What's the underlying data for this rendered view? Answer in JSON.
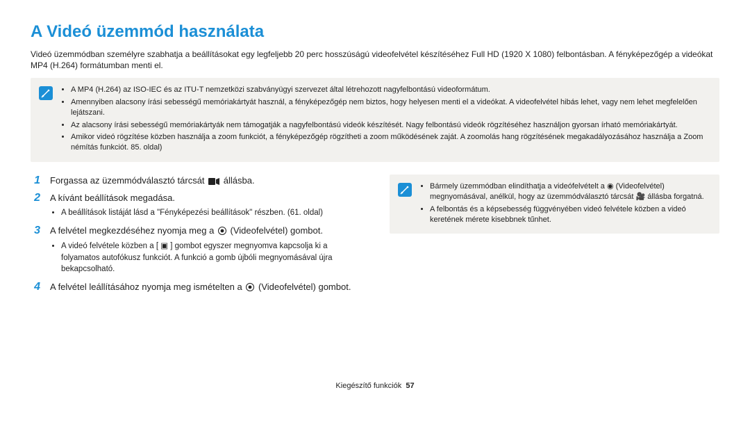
{
  "title": "A Videó üzemmód használata",
  "intro": "Videó üzemmódban személyre szabhatja a beállításokat egy legfeljebb 20 perc hosszúságú videofelvétel készítéséhez Full HD (1920 X 1080) felbontásban. A fényképezőgép a videókat MP4 (H.264) formátumban menti el.",
  "notes_top": [
    "A MP4 (H.264) az ISO-IEC és az ITU-T nemzetközi szabványügyi szervezet által létrehozott nagyfelbontású videoformátum.",
    "Amennyiben alacsony írási sebességű memóriakártyát használ, a fényképezőgép nem biztos, hogy helyesen menti el a videókat. A videofelvétel hibás lehet, vagy nem lehet megfelelően lejátszani.",
    "Az alacsony írási sebességű memóriakártyák nem támogatják a nagyfelbontású videók készítését. Nagy felbontású videók rögzítéséhez használjon gyorsan írható memóriakártyát.",
    "Amikor videó rögzítése közben használja a zoom funkciót, a fényképezőgép rögzítheti a zoom működésének zaját. A zoomolás hang rögzítésének megakadályozásához használja a Zoom némítás funkciót. 85. oldal)"
  ],
  "steps": [
    {
      "num": "1",
      "text_pre": "Forgassa az üzemmódválasztó tárcsát ",
      "icon": "video-mode-icon",
      "text_post": " állásba.",
      "sub": []
    },
    {
      "num": "2",
      "text_pre": "A kívánt beállítások megadása.",
      "icon": null,
      "text_post": "",
      "sub": [
        "A beállítások listáját lásd a \"Fényképezési beállítások\" részben. (61. oldal)"
      ]
    },
    {
      "num": "3",
      "text_pre": "A felvétel megkezdéséhez nyomja meg a ",
      "icon": "record-icon",
      "text_post": " (Videofelvétel) gombot.",
      "sub": [
        "A videó felvétele közben a [ ▣ ] gombot egyszer megnyomva kapcsolja ki a folyamatos autofókusz funkciót. A funkció a gomb újbóli megnyomásával újra bekapcsolható."
      ]
    },
    {
      "num": "4",
      "text_pre": "A felvétel leállításához nyomja meg ismételten a ",
      "icon": "record-icon",
      "text_post": " (Videofelvétel) gombot.",
      "sub": []
    }
  ],
  "notes_right": [
    "Bármely üzemmódban elindíthatja a videófelvételt a ◉ (Videofelvétel) megnyomásával, anélkül, hogy az üzemmódválasztó tárcsát 🎥 állásba forgatná.",
    "A felbontás és a képsebesség függvényében videó felvétele közben a videó keretének mérete kisebbnek tűnhet."
  ],
  "footer_label": "Kiegészítő funkciók",
  "footer_page": "57"
}
